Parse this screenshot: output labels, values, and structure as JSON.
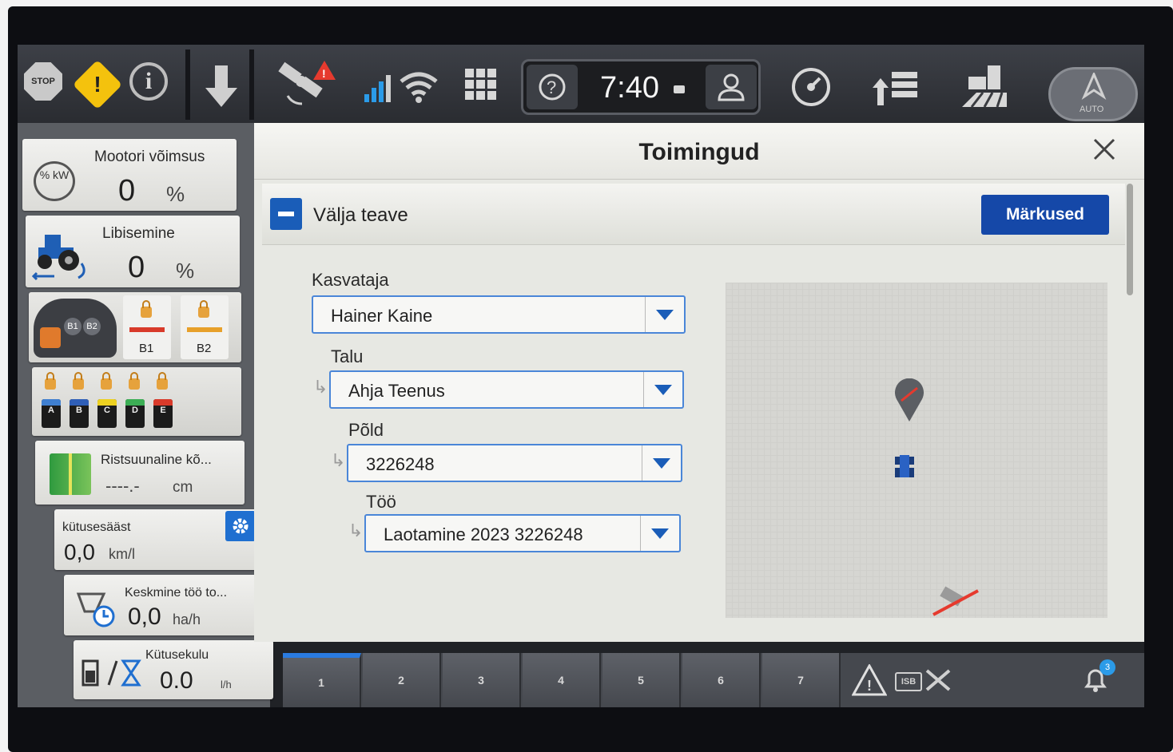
{
  "topbar": {
    "stop_label": "STOP",
    "clock_time": "7:40",
    "auto_label": "AUTO"
  },
  "left_panel": {
    "engine_power": {
      "title": "Mootori võimsus",
      "value": "0",
      "unit": "%",
      "icon_label": "% kW"
    },
    "slip": {
      "title": "Libisemine",
      "value": "0",
      "unit": "%"
    },
    "hitch": {
      "b1": "B1",
      "b2": "B2",
      "joystick_b1": "B1",
      "joystick_b2": "B2"
    },
    "valves": [
      "A",
      "B",
      "C",
      "D",
      "E"
    ],
    "valve_colors": [
      "#3f7fd0",
      "#2f5fb8",
      "#ecd020",
      "#3cae55",
      "#d83a2a"
    ],
    "cross_track": {
      "title": "Ristsuunaline kõ...",
      "value": "----.-",
      "unit": "cm"
    },
    "fuel_economy": {
      "title": "kütusesääst",
      "value": "0,0",
      "unit": "km/l"
    },
    "avg_work_rate": {
      "title": "Keskmine töö to...",
      "value": "0,0",
      "unit": "ha/h"
    },
    "fuel_consumption": {
      "title": "Kütusekulu",
      "value": "0.0",
      "unit": "l/h"
    }
  },
  "dialog": {
    "title": "Toimingud",
    "section_title": "Välja teave",
    "notes_button": "Märkused",
    "fields": {
      "grower_label": "Kasvataja",
      "grower_value": "Hainer Kaine",
      "farm_label": "Talu",
      "farm_value": "Ahja Teenus",
      "field_label": "Põld",
      "field_value": "3226248",
      "job_label": "Töö",
      "job_value": "Laotamine 2023 3226248"
    }
  },
  "bottombar": {
    "tabs": [
      "1",
      "2",
      "3",
      "4",
      "5",
      "6",
      "7"
    ],
    "active_tab": "1",
    "isobus_label": "ISB",
    "bell_badge": "3"
  }
}
